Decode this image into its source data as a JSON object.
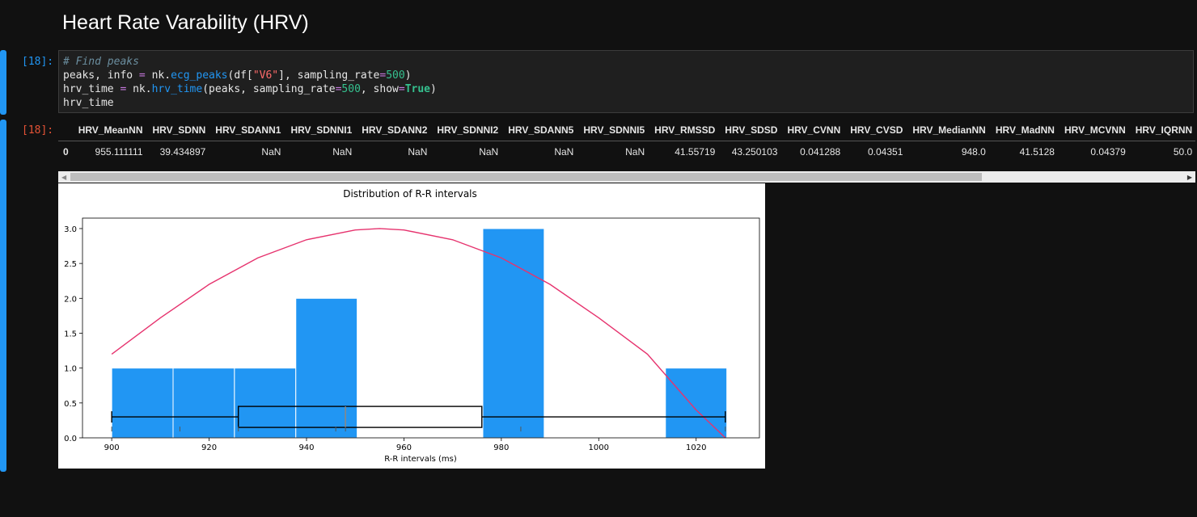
{
  "notebook": {
    "heading": "Heart Rate Varability (HRV)",
    "input_prompt": "[18]:",
    "output_prompt": "[18]:",
    "code": {
      "line1_comment": "# Find peaks",
      "line2": [
        "peaks, info ",
        "=",
        " nk.",
        "ecg_peaks",
        "(df[",
        "\"V6\"",
        "], sampling_rate",
        "=",
        "500",
        ")"
      ],
      "line3": [
        "hrv_time ",
        "=",
        " nk.",
        "hrv_time",
        "(peaks, sampling_rate",
        "=",
        "500",
        ", show",
        "=",
        "True",
        ")"
      ],
      "line4": "hrv_time"
    }
  },
  "table": {
    "columns": [
      "",
      "HRV_MeanNN",
      "HRV_SDNN",
      "HRV_SDANN1",
      "HRV_SDNNI1",
      "HRV_SDANN2",
      "HRV_SDNNI2",
      "HRV_SDANN5",
      "HRV_SDNNI5",
      "HRV_RMSSD",
      "HRV_SDSD",
      "HRV_CVNN",
      "HRV_CVSD",
      "HRV_MedianNN",
      "HRV_MadNN",
      "HRV_MCVNN",
      "HRV_IQRNN"
    ],
    "rows": [
      [
        "0",
        "955.111111",
        "39.434897",
        "NaN",
        "NaN",
        "NaN",
        "NaN",
        "NaN",
        "NaN",
        "41.55719",
        "43.250103",
        "0.041288",
        "0.04351",
        "948.0",
        "41.5128",
        "0.04379",
        "50.0"
      ]
    ]
  },
  "chart_data": {
    "type": "bar",
    "title": "Distribution of R-R intervals",
    "xlabel": "R-R intervals (ms)",
    "ylabel": "",
    "xlim": [
      894,
      1033
    ],
    "ylim": [
      0,
      3.15
    ],
    "xticks": [
      "900",
      "920",
      "940",
      "960",
      "980",
      "1000",
      "1020"
    ],
    "yticks": [
      "0.0",
      "0.5",
      "1.0",
      "1.5",
      "2.0",
      "2.5",
      "3.0"
    ],
    "bin_width": 12.6,
    "bars": [
      {
        "x": 900.0,
        "value": 1
      },
      {
        "x": 912.6,
        "value": 1
      },
      {
        "x": 925.2,
        "value": 1
      },
      {
        "x": 937.8,
        "value": 2
      },
      {
        "x": 976.2,
        "value": 3
      },
      {
        "x": 1013.7,
        "value": 1
      }
    ],
    "density_curve": {
      "x": [
        900,
        910,
        920,
        930,
        940,
        950,
        955,
        960,
        970,
        980,
        990,
        1000,
        1010,
        1020,
        1026
      ],
      "y": [
        1.2,
        1.72,
        2.2,
        2.58,
        2.84,
        2.98,
        3.0,
        2.98,
        2.84,
        2.58,
        2.2,
        1.72,
        1.2,
        0.4,
        0.0
      ]
    },
    "boxplot": {
      "min": 900,
      "q1": 926,
      "median": 948,
      "q3": 976,
      "max": 1026,
      "y": 0.3
    },
    "rug": [
      900,
      914,
      926,
      946,
      948,
      984,
      1026
    ],
    "bar_color": "#2196f3",
    "curve_color": "#e6336e"
  }
}
